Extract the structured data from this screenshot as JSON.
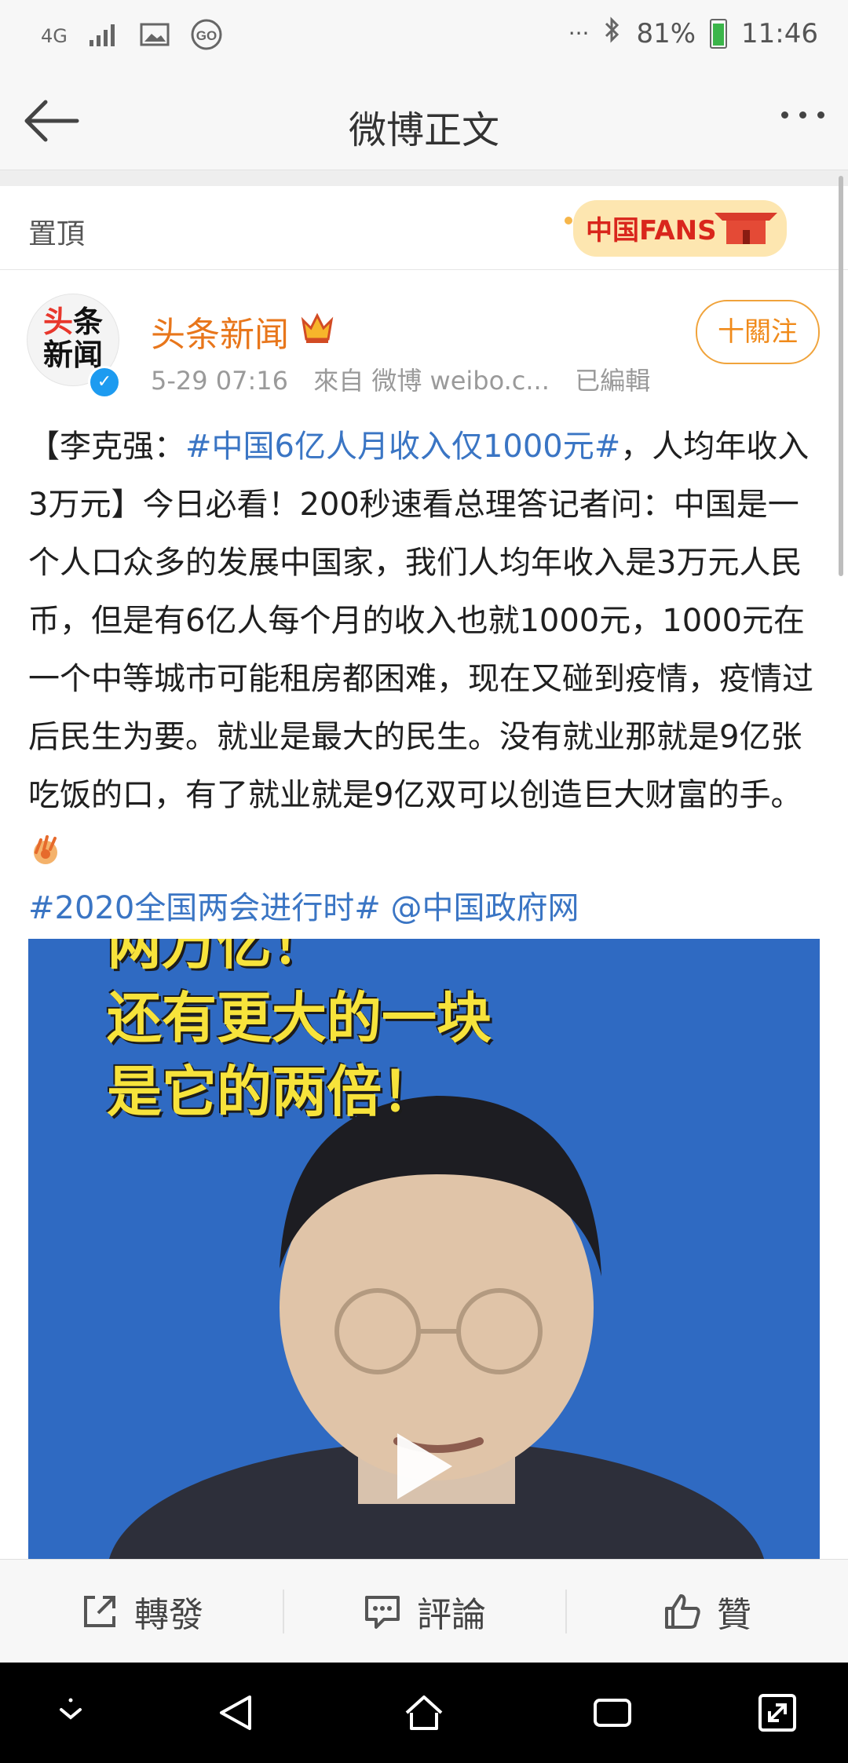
{
  "status_bar": {
    "network": "4G",
    "battery": "81%",
    "time": "11:46"
  },
  "title_bar": {
    "title": "微博正文"
  },
  "pinned": {
    "label": "置頂",
    "badge_text": "中国FANS"
  },
  "author": {
    "avatar_line1_red": "头",
    "avatar_line1_rest": "条",
    "avatar_line2": "新闻",
    "name": "头条新闻",
    "time": "5-29 07:16",
    "source": "來自 微博 weibo.c...",
    "edited": "已編輯",
    "follow": "十關注"
  },
  "post": {
    "prefix": "【李克强：",
    "topic": "#中国6亿人月收入仅1000元#",
    "body": "，人均年收入3万元】今日必看！200秒速看总理答记者问：中国是一个人口众多的发展中国家，我们人均年收入是3万元人民币，但是有6亿人每个月的收入也就1000元，1000元在一个中等城市可能租房都困难，现在又碰到疫情，疫情过后民生为要。就业是最大的民生。没有就业那就是9亿张吃饭的口，有了就业就是9亿双可以创造巨大财富的手。",
    "tag_topic": "#2020全国两会进行时#",
    "tag_mention": "@中国政府网"
  },
  "video": {
    "caption_line1": "两万亿！",
    "caption_line2": "还有更大的一块",
    "caption_line3": "是它的两倍！"
  },
  "actions": {
    "repost": "轉發",
    "comment": "評論",
    "like": "贊"
  },
  "colors": {
    "topic_blue": "#3a75c4",
    "author_orange": "#e8761b",
    "video_bg": "#2f6ac2",
    "caption_yellow": "#f7e33b"
  }
}
